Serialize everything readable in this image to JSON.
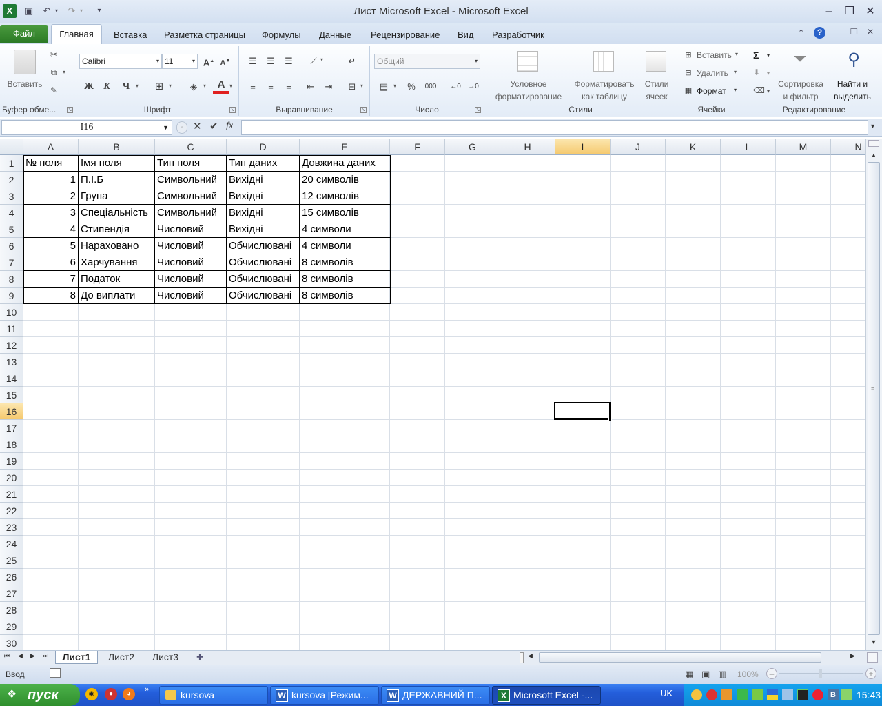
{
  "window": {
    "title": "Лист Microsoft Excel  -  Microsoft Excel"
  },
  "ribbon_tabs": [
    "Файл",
    "Главная",
    "Вставка",
    "Разметка страницы",
    "Формулы",
    "Данные",
    "Рецензирование",
    "Вид",
    "Разработчик"
  ],
  "ribbon": {
    "clipboard": {
      "paste": "Вставить",
      "group": "Буфер обме..."
    },
    "font": {
      "name": "Calibri",
      "size": "11",
      "bold": "Ж",
      "italic": "К",
      "underline": "Ч",
      "group": "Шрифт"
    },
    "alignment": {
      "group": "Выравнивание"
    },
    "number": {
      "format": "Общий",
      "percent": "%",
      "thousands": "000",
      "group": "Число"
    },
    "styles": {
      "conditional_1": "Условное",
      "conditional_2": "форматирование",
      "table_1": "Форматировать",
      "table_2": "как таблицу",
      "cell_1": "Стили",
      "cell_2": "ячеек",
      "group": "Стили"
    },
    "cells": {
      "insert": "Вставить",
      "delete": "Удалить",
      "format": "Формат",
      "group": "Ячейки"
    },
    "editing": {
      "sum": "Σ",
      "sort_1": "Сортировка",
      "sort_2": "и фильтр",
      "find_1": "Найти и",
      "find_2": "выделить",
      "group": "Редактирование"
    }
  },
  "formula_bar": {
    "name_box": "I16",
    "fx": "fx",
    "formula": ""
  },
  "columns": [
    "A",
    "B",
    "C",
    "D",
    "E",
    "F",
    "G",
    "H",
    "I",
    "J",
    "K",
    "L",
    "M",
    "N"
  ],
  "rows": [
    "1",
    "2",
    "3",
    "4",
    "5",
    "6",
    "7",
    "8",
    "9",
    "10",
    "11",
    "12",
    "13",
    "14",
    "15",
    "16",
    "17",
    "18",
    "19",
    "20",
    "21",
    "22",
    "23",
    "24",
    "25",
    "26",
    "27",
    "28",
    "29",
    "30"
  ],
  "selected_cell": {
    "column": "I",
    "row": "16"
  },
  "table": {
    "header": [
      "№ поля",
      "Імя поля",
      "Тип поля",
      "Тип даних",
      "Довжина даних"
    ],
    "rows": [
      [
        "1",
        "П.І.Б",
        "Символьний",
        "Вихідні",
        "20 символів"
      ],
      [
        "2",
        "Група",
        "Символьний",
        "Вихідні",
        "12 символів"
      ],
      [
        "3",
        "Спеціальність",
        "Символьний",
        "Вихідні",
        "15 символів"
      ],
      [
        "4",
        "Стипендія",
        "Числовий",
        "Вихідні",
        "4 символи"
      ],
      [
        "5",
        "Нараховано",
        "Числовий",
        "Обчислювані",
        "4 символи"
      ],
      [
        "6",
        "Харчування",
        "Числовий",
        "Обчислювані",
        "8 символів"
      ],
      [
        "7",
        "Податок",
        "Числовий",
        "Обчислювані",
        "8 символів"
      ],
      [
        "8",
        "До виплати",
        "Числовий",
        "Обчислювані",
        "8 символів"
      ]
    ]
  },
  "sheets": [
    "Лист1",
    "Лист2",
    "Лист3"
  ],
  "active_sheet": "Лист1",
  "status": {
    "mode": "Ввод",
    "zoom": "100%"
  },
  "taskbar": {
    "start": "пуск",
    "items": [
      "kursova",
      "kursova [Режим...",
      "ДЕРЖАВНИЙ П...",
      "Microsoft Excel -..."
    ],
    "language": "UK",
    "clock": "15:43"
  }
}
